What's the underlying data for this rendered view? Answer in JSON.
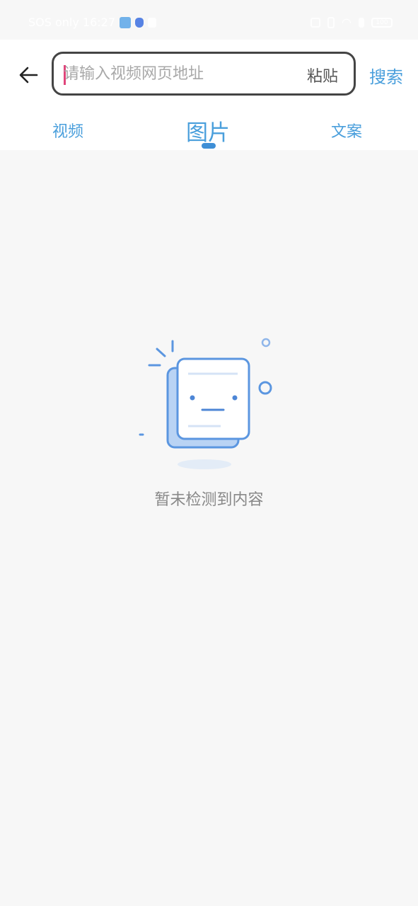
{
  "status_bar": {
    "text": "SOS only 16:27",
    "battery": "100"
  },
  "header": {
    "back_icon": "arrow-left-icon",
    "search": {
      "placeholder": "请输入视频网页地址",
      "value": "",
      "paste_label": "粘贴"
    },
    "search_button_label": "搜索"
  },
  "tabs": [
    {
      "label": "视频",
      "active": false
    },
    {
      "label": "图片",
      "active": true
    },
    {
      "label": "文案",
      "active": false
    }
  ],
  "empty_state": {
    "icon": "empty-document-icon",
    "message": "暂未检测到内容"
  },
  "colors": {
    "accent": "#4a9fdc",
    "caret": "#e0457b",
    "background": "#f7f7f7"
  }
}
